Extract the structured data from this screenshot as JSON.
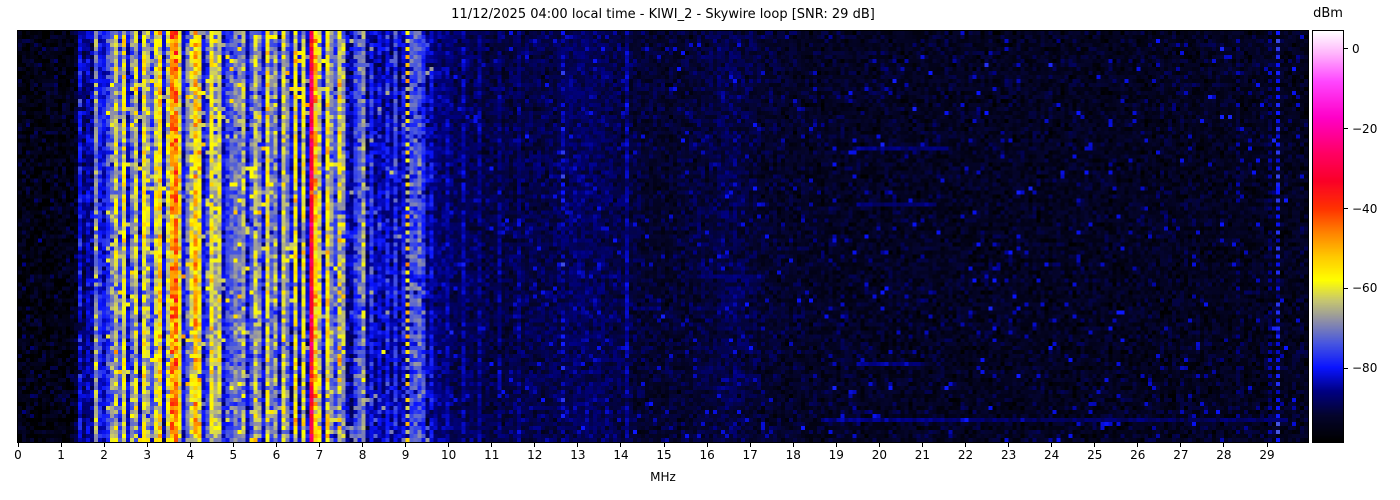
{
  "title": "11/12/2025 04:00 local time - KIWI_2 - Skywire loop [SNR: 29 dB]",
  "x_axis": {
    "label": "MHz",
    "ticks": [
      "0",
      "1",
      "2",
      "3",
      "4",
      "5",
      "6",
      "7",
      "8",
      "9",
      "10",
      "11",
      "12",
      "13",
      "14",
      "15",
      "16",
      "17",
      "18",
      "19",
      "20",
      "21",
      "22",
      "23",
      "24",
      "25",
      "26",
      "27",
      "28",
      "29"
    ],
    "tick_values": [
      0,
      1,
      2,
      3,
      4,
      5,
      6,
      7,
      8,
      9,
      10,
      11,
      12,
      13,
      14,
      15,
      16,
      17,
      18,
      19,
      20,
      21,
      22,
      23,
      24,
      25,
      26,
      27,
      28,
      29
    ]
  },
  "colorbar": {
    "label": "dBm",
    "ticks": [
      "0",
      "−20",
      "−40",
      "−60",
      "−80"
    ],
    "tick_values": [
      0,
      -20,
      -40,
      -60,
      -80
    ],
    "vmin": -98.5,
    "vmax": 4.5
  },
  "chart_data": {
    "type": "heatmap",
    "subtype": "radio-spectrum-waterfall",
    "title": "11/12/2025 04:00 local time - KIWI_2 - Skywire loop [SNR: 29 dB]",
    "xlabel": "MHz",
    "x_range_mhz": [
      0,
      29.95
    ],
    "y_axis": "time (no tick labels shown)",
    "colorbar_label": "dBm",
    "value_range_dbm": [
      -98.5,
      4.5
    ],
    "grid_cols": 323,
    "grid_rows": 103,
    "seed": 42,
    "colormap_stops": [
      [
        -98.5,
        0,
        0,
        0
      ],
      [
        -92,
        4,
        4,
        45
      ],
      [
        -86,
        0,
        0,
        130
      ],
      [
        -80,
        10,
        20,
        255
      ],
      [
        -74,
        70,
        85,
        225
      ],
      [
        -68,
        145,
        145,
        165
      ],
      [
        -63,
        200,
        200,
        110
      ],
      [
        -58,
        255,
        255,
        0
      ],
      [
        -52,
        255,
        200,
        0
      ],
      [
        -46,
        255,
        130,
        0
      ],
      [
        -40,
        255,
        50,
        0
      ],
      [
        -33,
        250,
        0,
        40
      ],
      [
        -26,
        255,
        0,
        100
      ],
      [
        -17,
        255,
        0,
        200
      ],
      [
        -8,
        255,
        70,
        255
      ],
      [
        -1,
        255,
        180,
        252
      ],
      [
        4.5,
        255,
        255,
        255
      ]
    ],
    "noise_profile": [
      [
        0,
        -96
      ],
      [
        1.3,
        -95.5
      ],
      [
        1.5,
        -88
      ],
      [
        1.8,
        -84
      ],
      [
        2.0,
        -82
      ],
      [
        7.5,
        -82
      ],
      [
        7.7,
        -85
      ],
      [
        9.6,
        -86
      ],
      [
        10.2,
        -89
      ],
      [
        11.0,
        -90.5
      ],
      [
        12.0,
        -90
      ],
      [
        12.4,
        -90
      ],
      [
        12.8,
        -88.5
      ],
      [
        13.4,
        -88.5
      ],
      [
        14.0,
        -90.5
      ],
      [
        14.6,
        -92
      ],
      [
        15.0,
        -92.5
      ],
      [
        16.0,
        -91
      ],
      [
        16.6,
        -89.5
      ],
      [
        17.2,
        -92
      ],
      [
        18.0,
        -93
      ],
      [
        20.0,
        -93.5
      ],
      [
        29.95,
        -94
      ]
    ],
    "noise_sigma": [
      [
        0,
        9.6,
        3.0
      ],
      [
        9.6,
        29.95,
        2.2
      ]
    ],
    "stripes": [
      [
        1.47,
        0.05,
        -80,
        3
      ],
      [
        1.58,
        0.04,
        -84,
        3
      ],
      [
        1.77,
        0.04,
        -68,
        4
      ],
      [
        1.93,
        0.05,
        -79,
        3
      ],
      [
        2.05,
        0.06,
        -76,
        3
      ],
      [
        2.16,
        0.05,
        -70,
        4
      ],
      [
        2.28,
        0.07,
        -62,
        4
      ],
      [
        2.4,
        0.05,
        -74,
        4
      ],
      [
        2.5,
        0.08,
        -60,
        4
      ],
      [
        2.62,
        0.05,
        -70,
        4
      ],
      [
        2.74,
        0.06,
        -63,
        4
      ],
      [
        2.9,
        0.1,
        -58,
        4
      ],
      [
        3.0,
        0.05,
        -66,
        4
      ],
      [
        3.1,
        0.05,
        -76,
        3
      ],
      [
        3.22,
        0.06,
        -61,
        4
      ],
      [
        3.32,
        0.05,
        -55,
        5
      ],
      [
        3.44,
        0.06,
        -62,
        4
      ],
      [
        3.55,
        0.05,
        -48,
        5
      ],
      [
        3.65,
        0.04,
        -44,
        5
      ],
      [
        3.8,
        0.07,
        -58,
        4
      ],
      [
        3.93,
        0.05,
        -70,
        3
      ],
      [
        4.02,
        0.05,
        -62,
        4
      ],
      [
        4.12,
        0.05,
        -52,
        5
      ],
      [
        4.25,
        0.05,
        -57,
        5
      ],
      [
        4.38,
        0.05,
        -74,
        3
      ],
      [
        4.5,
        0.06,
        -59,
        4
      ],
      [
        4.62,
        0.04,
        -65,
        4
      ],
      [
        4.72,
        0.04,
        -62,
        4
      ],
      [
        4.85,
        0.05,
        -76,
        3
      ],
      [
        4.97,
        0.05,
        -73,
        3
      ],
      [
        5.1,
        0.05,
        -70,
        3
      ],
      [
        5.27,
        0.05,
        -66,
        4
      ],
      [
        5.4,
        0.05,
        -74,
        3
      ],
      [
        5.52,
        0.07,
        -63,
        4
      ],
      [
        5.65,
        0.04,
        -68,
        3
      ],
      [
        5.76,
        0.06,
        -59,
        4
      ],
      [
        5.9,
        0.05,
        -72,
        3
      ],
      [
        6.02,
        0.06,
        -66,
        4
      ],
      [
        6.13,
        0.05,
        -62,
        4
      ],
      [
        6.25,
        0.05,
        -70,
        3
      ],
      [
        6.45,
        0.07,
        -57,
        4
      ],
      [
        6.66,
        0.05,
        -60,
        4
      ],
      [
        6.8,
        0.035,
        -30,
        4
      ],
      [
        6.9,
        0.05,
        -52,
        5
      ],
      [
        7.02,
        0.05,
        -62,
        4
      ],
      [
        7.15,
        0.06,
        -57,
        4
      ],
      [
        7.28,
        0.05,
        -68,
        3
      ],
      [
        7.38,
        0.06,
        -74,
        3
      ],
      [
        7.5,
        0.04,
        -60,
        6
      ],
      [
        7.6,
        0.04,
        -66,
        4
      ],
      [
        7.8,
        0.05,
        -76,
        3
      ],
      [
        7.95,
        0.06,
        -73,
        3
      ],
      [
        8.05,
        0.04,
        -67,
        4
      ],
      [
        8.17,
        0.04,
        -78,
        3
      ],
      [
        8.35,
        0.03,
        -82,
        3
      ],
      [
        8.6,
        0.04,
        -79,
        3
      ],
      [
        8.8,
        0.04,
        -77,
        3
      ],
      [
        8.95,
        0.04,
        -80,
        3
      ],
      [
        9.05,
        0.04,
        -58,
        6,
        1
      ],
      [
        9.18,
        0.04,
        -74,
        3
      ],
      [
        9.32,
        0.05,
        -72,
        3
      ],
      [
        9.45,
        0.04,
        -77,
        3
      ],
      [
        9.6,
        0.03,
        -82,
        3
      ],
      [
        10.0,
        0.03,
        -85,
        2
      ],
      [
        10.35,
        0.03,
        -84,
        2
      ],
      [
        10.75,
        0.03,
        -86,
        2
      ],
      [
        11.2,
        0.03,
        -86,
        2
      ],
      [
        11.6,
        0.03,
        -87,
        2
      ],
      [
        12.63,
        0.04,
        -82,
        3,
        1
      ],
      [
        14.12,
        0.025,
        -85,
        2
      ],
      [
        28.35,
        0.03,
        -88,
        2,
        1
      ],
      [
        29.1,
        0.03,
        -87,
        2,
        1
      ],
      [
        29.25,
        0.04,
        -79,
        2,
        1
      ]
    ],
    "flecks": [
      {
        "range": [
          2.0,
          7.6
        ],
        "prob": 0.06,
        "level": -62,
        "sd": 6
      },
      {
        "range": [
          7.6,
          9.6
        ],
        "prob": 0.03,
        "level": -70,
        "sd": 5
      },
      {
        "range": [
          9.6,
          29.95
        ],
        "prob": 0.03,
        "level": -83,
        "sd": 2
      },
      {
        "range": [
          0,
          1.4
        ],
        "prob": 0.03,
        "level": -90,
        "sd": 2
      }
    ],
    "horizontal_lines": [
      [
        19.4,
        21.6,
        0.28,
        -87
      ],
      [
        19.6,
        21.2,
        0.42,
        -87
      ],
      [
        15.9,
        17.3,
        0.6,
        -88
      ],
      [
        19.5,
        21.0,
        0.81,
        -86
      ],
      [
        18.6,
        21.5,
        0.95,
        -86
      ],
      [
        21.5,
        29.5,
        0.955,
        -88
      ]
    ]
  }
}
